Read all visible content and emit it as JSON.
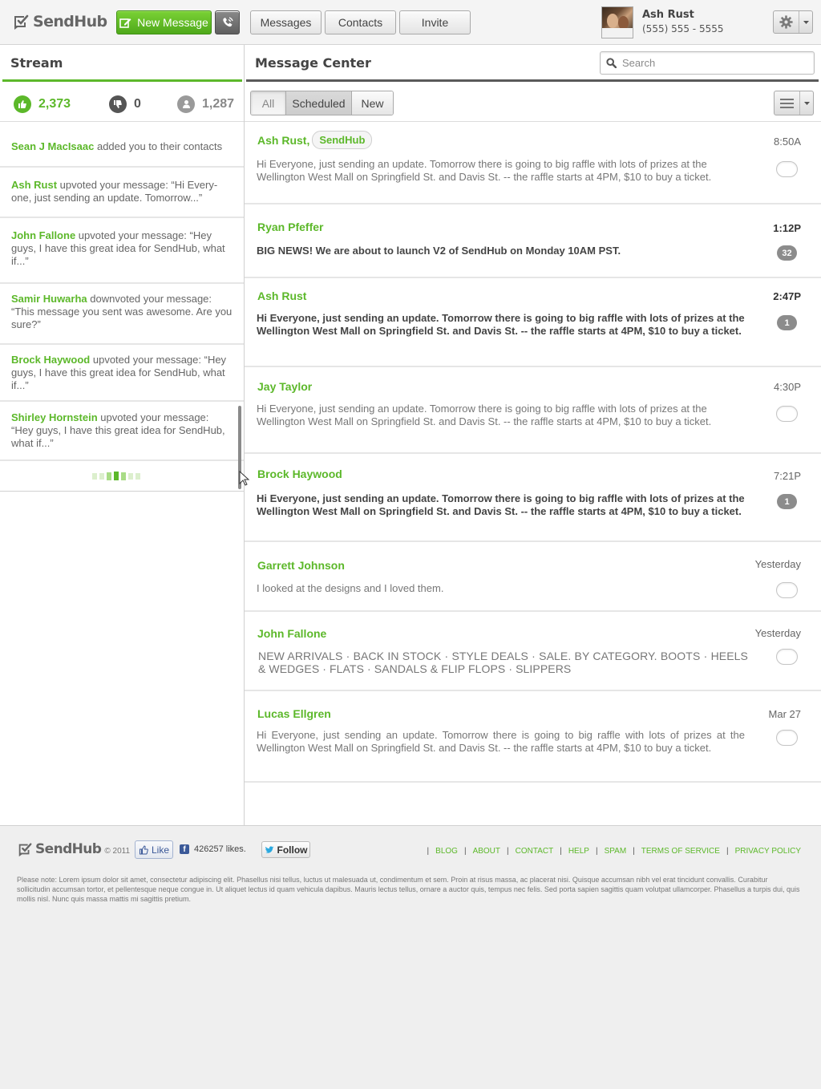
{
  "header": {
    "logo_text": "SendHub",
    "new_message_label": "New Message",
    "nav": [
      "Messages",
      "Contacts",
      "Invite"
    ],
    "user": {
      "name": "Ash Rust",
      "phone": "(555) 555 - 5555"
    }
  },
  "stream": {
    "title": "Stream",
    "counts": {
      "upvotes": "2,373",
      "downvotes": "0",
      "contacts": "1,287"
    },
    "items": [
      {
        "who": "Sean J MacIsaac",
        "text": " added you to their contacts"
      },
      {
        "who": "Ash Rust",
        "text": " upvoted your message: “Hi Every-one, just sending an update. Tomorrow...”"
      },
      {
        "who": "John Fallone",
        "text": " upvoted your message: “Hey guys, I have this great idea for SendHub, what if...”"
      },
      {
        "who": "Samir Huwarha",
        "text": " downvoted your message: “This message you sent was awesome. Are you sure?”"
      },
      {
        "who": "Brock Haywood",
        "text": " upvoted your message: “Hey guys, I have this great idea for SendHub, what if...”"
      },
      {
        "who": "Shirley Hornstein",
        "text": " upvoted your message: “Hey guys, I have this great idea for SendHub, what if...”"
      }
    ]
  },
  "message_center": {
    "title": "Message Center",
    "search_placeholder": "Search",
    "tabs": [
      "All",
      "Scheduled",
      "New"
    ],
    "messages": [
      {
        "sender": "Ash Rust,",
        "tag": "SendHub",
        "time": "8:50A",
        "text": "Hi Everyone, just sending an update. Tomorrow there is going to big raffle with lots of prizes at the Wellington West Mall on Springfield St. and Davis St. -- the raffle starts at 4PM, $10 to buy a ticket.",
        "unread": false,
        "badge": ""
      },
      {
        "sender": "Ryan Pfeffer",
        "tag": "",
        "time": "1:12P",
        "text": "BIG NEWS! We are about to launch V2 of SendHub on Monday 10AM PST.",
        "unread": true,
        "badge": "32"
      },
      {
        "sender": "Ash Rust",
        "tag": "",
        "time": "2:47P",
        "text": "Hi Everyone, just sending an update. Tomorrow there is going to big raffle with lots of prizes at the Wellington West Mall on Springfield St. and Davis St. -- the raffle starts at 4PM, $10 to buy a ticket.",
        "unread": true,
        "badge": "1"
      },
      {
        "sender": "Jay Taylor",
        "tag": "",
        "time": "4:30P",
        "text": "Hi Everyone, just sending an update. Tomorrow there is going to big raffle with lots of prizes at the Wellington West Mall on Springfield St. and Davis St. -- the raffle starts at 4PM, $10 to buy a ticket.",
        "unread": false,
        "badge": ""
      },
      {
        "sender": "Brock Haywood",
        "tag": "",
        "time": "7:21P",
        "text": "Hi Everyone, just sending an update. Tomorrow there is going to big raffle with lots of prizes at the Wellington West Mall on Springfield St. and Davis St. -- the raffle starts at 4PM, $10 to buy a ticket.",
        "unread": true,
        "badge": "1"
      },
      {
        "sender": "Garrett Johnson",
        "tag": "",
        "time": "Yesterday",
        "text": "I looked at the designs and I loved them.",
        "unread": false,
        "badge": ""
      },
      {
        "sender": "John Fallone",
        "tag": "",
        "time": "Yesterday",
        "text": "NEW ARRIVALS · BACK IN STOCK · STYLE DEALS · SALE. BY CATEGORY. BOOTS · HEELS & WEDGES · FLATS · SANDALS & FLIP FLOPS · SLIPPERS",
        "unread": false,
        "badge": ""
      },
      {
        "sender": "Lucas Ellgren",
        "tag": "",
        "time": "Mar 27",
        "text": "Hi Everyone, just sending an update. Tomorrow there is going to big raffle with lots of prizes at the Wellington West Mall on Springfield St. and Davis St. -- the raffle starts at 4PM, $10 to buy a ticket.",
        "unread": false,
        "badge": ""
      }
    ]
  },
  "footer": {
    "logo_text": "SendHub",
    "copyright": "© 2011",
    "like_label": "Like",
    "likes": "426257 likes.",
    "follow_label": "Follow",
    "links": [
      "BLOG",
      "ABOUT",
      "CONTACT",
      "HELP",
      "SPAM",
      "TERMS OF SERVICE",
      "PRIVACY POLICY"
    ],
    "note": "Please note: Lorem ipsum dolor sit amet, consectetur adipiscing elit. Phasellus nisi tellus, luctus ut malesuada ut, condimentum et sem. Proin at risus massa, ac placerat nisi. Quisque accumsan nibh vel erat tincidunt convallis. Curabitur sollicitudin accumsan tortor, et pellentesque neque congue in. Ut aliquet lectus id quam vehicula dapibus. Mauris lectus tellus, ornare a auctor quis, tempus nec felis. Sed porta sapien sagittis quam volutpat ullamcorper. Phasellus a turpis dui, quis mollis nisl. Nunc quis massa mattis mi sagittis pretium."
  },
  "colors": {
    "brand_green": "#5cb82a",
    "badge_gray": "#8c8c8c"
  }
}
